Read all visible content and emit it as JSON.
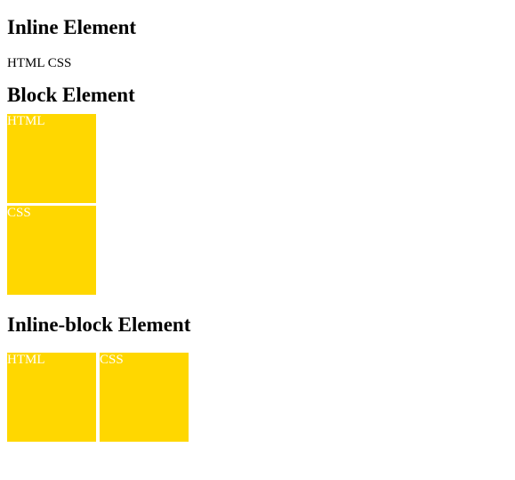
{
  "sections": {
    "inline": {
      "heading": "Inline Element",
      "items": [
        "HTML",
        "CSS"
      ]
    },
    "block": {
      "heading": "Block Element",
      "items": [
        "HTML",
        "CSS"
      ]
    },
    "inline_block": {
      "heading": "Inline-block Element",
      "items": [
        "HTML",
        "CSS"
      ]
    }
  },
  "colors": {
    "box_background": "#ffd700",
    "box_text": "#ffffff"
  }
}
